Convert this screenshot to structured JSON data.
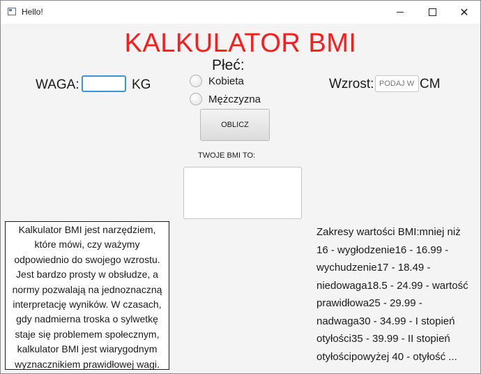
{
  "window": {
    "title": "Hello!"
  },
  "titlebar_buttons": {
    "minimize_icon": "minimize-icon",
    "maximize_icon": "maximize-icon",
    "close_icon": "close-icon",
    "close_glyph": "✕"
  },
  "header": {
    "title": "KALKULATOR BMI",
    "title_color": "#ff1a1a"
  },
  "form": {
    "gender_label": "Płeć:",
    "weight_label": "WAGA:",
    "weight_value": "",
    "weight_unit": "KG",
    "gender_options": [
      {
        "label": "Kobieta",
        "selected": false
      },
      {
        "label": "Mężczyzna",
        "selected": false
      }
    ],
    "height_label": "Wzrost:",
    "height_placeholder": "PODAJ W",
    "height_unit": "CM",
    "calculate_label": "OBLICZ",
    "result_label": "TWOJE BMI TO:",
    "result_value": ""
  },
  "description": {
    "lines": [
      "Kalkulator BMI  jest narzędziem,",
      "które mówi, czy ważymy",
      "odpowiednio do swojego wzrostu.",
      "Jest bardzo prosty w obsłudze, a",
      "normy pozwalają na jednoznaczną",
      "interpretację wyników. W czasach,",
      "gdy nadmierna troska o sylwetkę",
      "staje się problemem społecznym,",
      "kalkulator BMI jest wiarygodnym",
      "wyznacznikiem prawidłowej wagi."
    ]
  },
  "ranges": {
    "lines": [
      "Zakresy wartości BMI:mniej niż",
      "16 - wygłodzenie16 - 16.99 -",
      "wychudzenie17 - 18.49 -",
      "niedowaga18.5 - 24.99 - wartość",
      "prawidłowa25 - 29.99 -",
      "nadwaga30 - 34.99 - I stopień",
      "otyłości35 - 39.99 - II stopień",
      "otyłościpowyżej 40 - otyłość ..."
    ]
  }
}
